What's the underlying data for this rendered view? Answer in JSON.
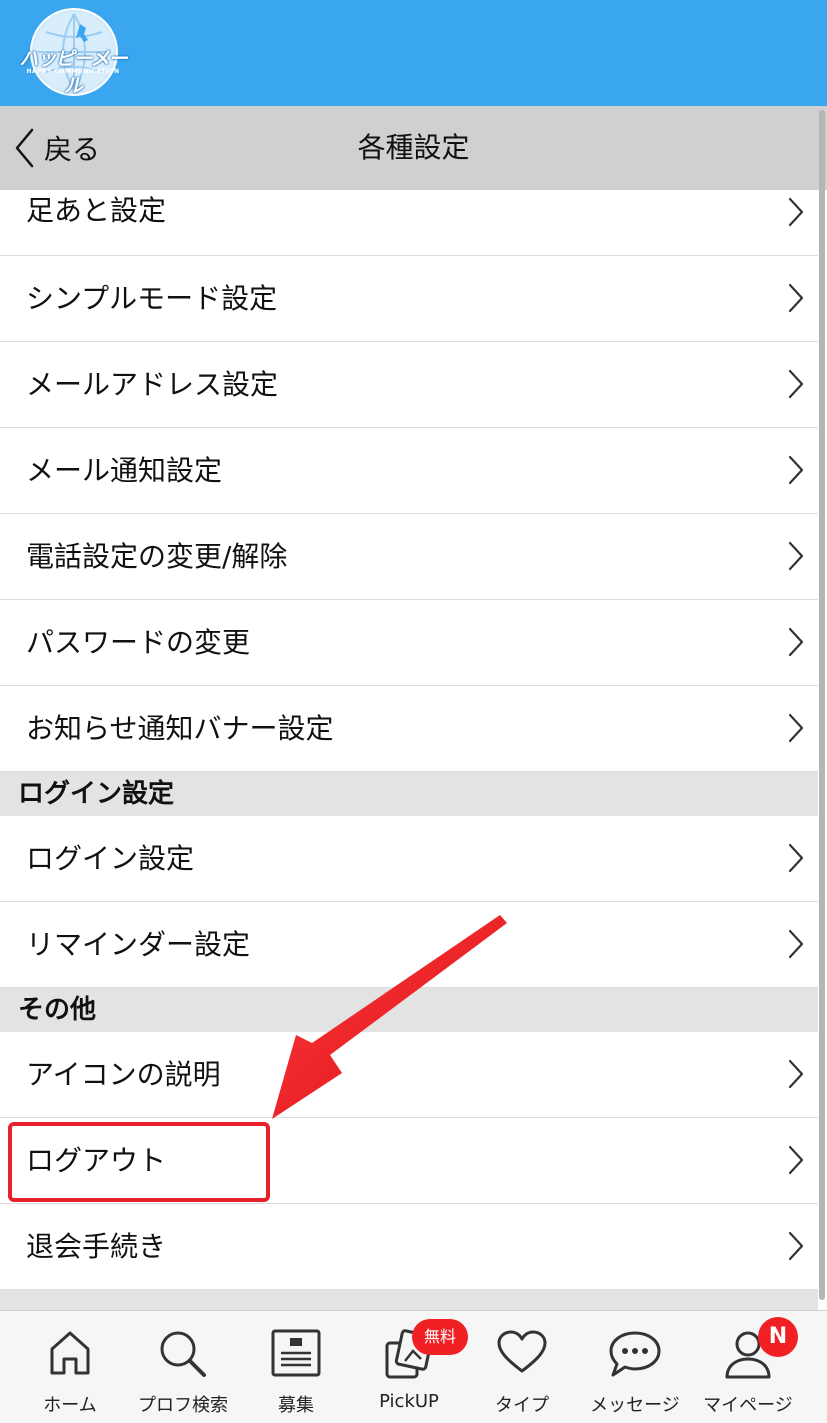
{
  "brand": {
    "logo_text": "ハッピーメール",
    "logo_subtext": "HAPPY COMMUNICATION"
  },
  "nav": {
    "back_label": "戻る",
    "title": "各種設定"
  },
  "rows_top": [
    {
      "label": "足あと設定"
    },
    {
      "label": "シンプルモード設定"
    },
    {
      "label": "メールアドレス設定"
    },
    {
      "label": "メール通知設定"
    },
    {
      "label": "電話設定の変更/解除"
    },
    {
      "label": "パスワードの変更"
    },
    {
      "label": "お知らせ通知バナー設定"
    }
  ],
  "section_login": {
    "title": "ログイン設定",
    "rows": [
      {
        "label": "ログイン設定"
      },
      {
        "label": "リマインダー設定"
      }
    ]
  },
  "section_other": {
    "title": "その他",
    "rows": [
      {
        "label": "アイコンの説明"
      },
      {
        "label": "ログアウト"
      },
      {
        "label": "退会手続き"
      }
    ]
  },
  "tabs": [
    {
      "label": "ホーム",
      "icon": "home-icon"
    },
    {
      "label": "プロフ検索",
      "icon": "search-icon"
    },
    {
      "label": "募集",
      "icon": "board-icon"
    },
    {
      "label": "PickUP",
      "icon": "pickup-icon",
      "badge": "無料"
    },
    {
      "label": "タイプ",
      "icon": "heart-icon"
    },
    {
      "label": "メッセージ",
      "icon": "message-icon"
    },
    {
      "label": "マイページ",
      "icon": "user-icon",
      "badge": "N"
    }
  ],
  "colors": {
    "brand_blue": "#3aa6f0",
    "nav_gray": "#d0d0d0",
    "section_gray": "#e3e3e3",
    "annotation_red": "#e8202a",
    "badge_red": "#f02025"
  }
}
